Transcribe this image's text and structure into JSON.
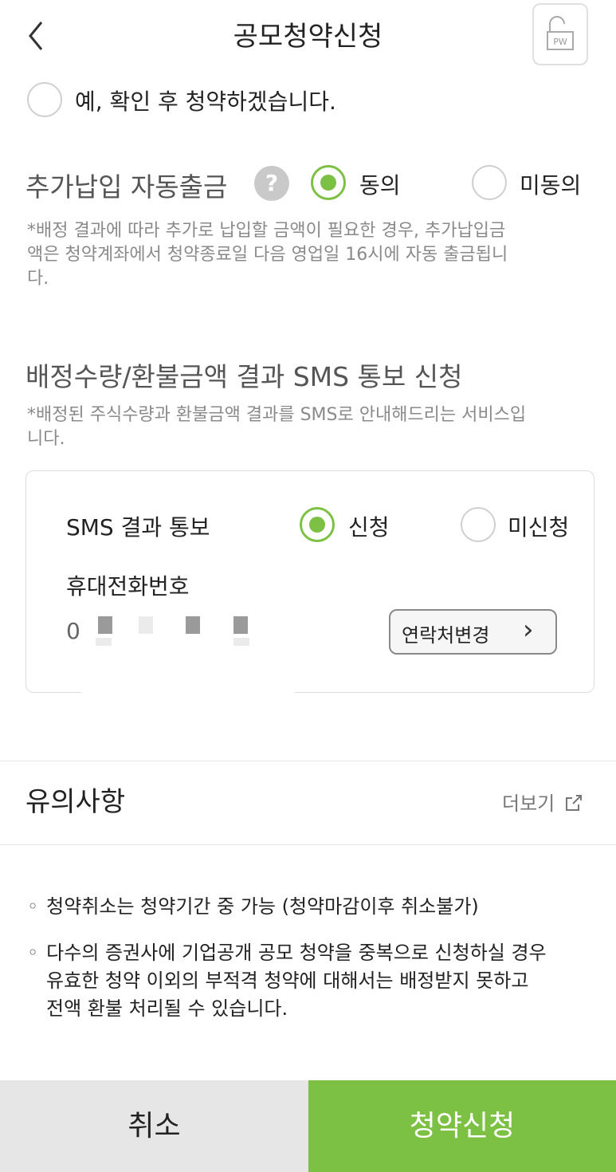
{
  "header": {
    "title": "공모청약신청",
    "pw_label": "PW"
  },
  "confirm": {
    "label": "예, 확인 후 청약하겠습니다."
  },
  "additional_payment": {
    "title": "추가납입 자동출금",
    "help": "?",
    "agree": "동의",
    "disagree": "미동의",
    "note_lines": [
      "*배정 결과에 따라 추가로 납입할 금액이 필요한 경우, 추가납입금",
      "액은 청약계좌에서 청약종료일 다음 영업일 16시에 자동 출금됩니",
      "다."
    ]
  },
  "sms": {
    "title": "배정수량/환불금액 결과 SMS 통보 신청",
    "note_lines": [
      "*배정된 주식수량과 환불금액 결과를 SMS로 안내해드리는 서비스입",
      "니다."
    ],
    "result_label": "SMS 결과 통보",
    "apply": "신청",
    "not_apply": "미신청",
    "phone_label": "휴대전화번호",
    "phone_prefix": "0",
    "change_contact": "연락처변경",
    "chevron": "›"
  },
  "notice": {
    "title": "유의사항",
    "more": "더보기",
    "bullets": [
      [
        "청약취소는 청약기간 중 가능 (청약마감이후 취소불가)"
      ],
      [
        "다수의 증권사에 기업공개 공모 청약을 중복으로 신청하실 경우",
        "유효한 청약 이외의 부적격 청약에 대해서는 배정받지 못하고",
        "전액 환불 처리될 수 있습니다."
      ]
    ]
  },
  "buttons": {
    "cancel": "취소",
    "submit": "청약신청"
  },
  "colors": {
    "accent": "#7cc143",
    "cancel_bg": "#e6e6e6"
  },
  "icons": [
    "back-arrow-icon",
    "password-lock-icon",
    "help-icon",
    "external-link-icon",
    "chevron-right-icon"
  ]
}
